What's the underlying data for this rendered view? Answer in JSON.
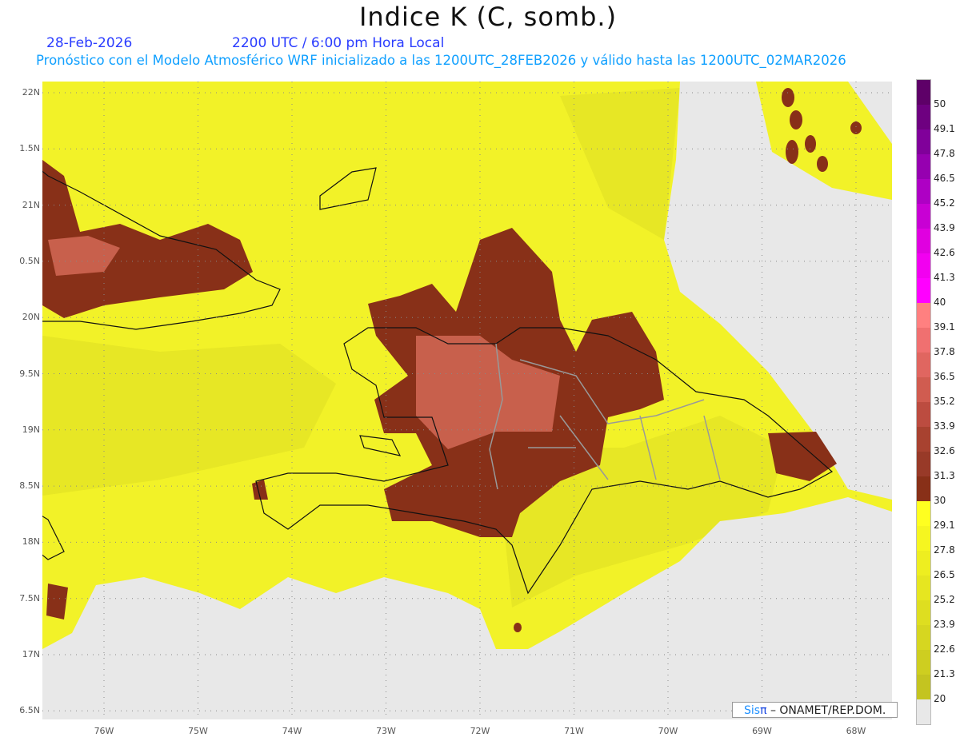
{
  "title": "Indice K (C, somb.)",
  "date": "28-Feb-2026",
  "time": "2200 UTC / 6:00 pm Hora Local",
  "info": "Pronóstico con el Modelo Atmosférico WRF inicializado a las 1200UTC_28FEB2026 y válido hasta las  1200UTC_02MAR2026",
  "lat_labels": [
    "22N",
    "1.5N",
    "21N",
    "0.5N",
    "20N",
    "9.5N",
    "19N",
    "8.5N",
    "18N",
    "7.5N",
    "17N",
    "6.5N"
  ],
  "lon_labels": [
    "76W",
    "75W",
    "74W",
    "73W",
    "72W",
    "71W",
    "70W",
    "69W",
    "68W"
  ],
  "colorbar": {
    "labels": [
      "50",
      "49.1",
      "47.8",
      "46.5",
      "45.2",
      "43.9",
      "42.6",
      "41.3",
      "40",
      "39.1",
      "37.8",
      "36.5",
      "35.2",
      "33.9",
      "32.6",
      "31.3",
      "30",
      "29.1",
      "27.8",
      "26.5",
      "25.2",
      "23.9",
      "22.6",
      "21.3",
      "20"
    ],
    "colors": [
      "#5e0068",
      "#6e0080",
      "#80009a",
      "#9600b0",
      "#ae00c4",
      "#c800d4",
      "#e000e0",
      "#f200f0",
      "#ff00ff",
      "#ff8080",
      "#f07070",
      "#e06660",
      "#d05c50",
      "#bc4c40",
      "#a84230",
      "#983a28",
      "#883018",
      "#ffff20",
      "#f6f620",
      "#eeee20",
      "#e6e620",
      "#dede20",
      "#d6d620",
      "#cece20",
      "#c4c420",
      "#e8e8e8"
    ]
  },
  "credit": {
    "a": "Sis",
    "b": "π",
    "c": " –  ONAMET/REP.DOM."
  },
  "colors": {
    "yellow": "#f2f228",
    "yellow_dark": "#e4e424",
    "gray": "#e8e8e8",
    "brown": "#883018",
    "salmon": "#c8604c"
  }
}
